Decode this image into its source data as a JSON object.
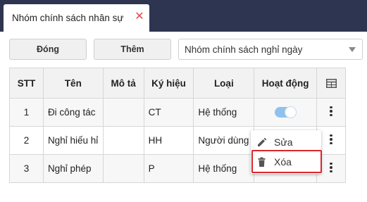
{
  "tab": {
    "title": "Nhóm chính sách nhân sự",
    "close_glyph": "✕"
  },
  "toolbar": {
    "close_label": "Đóng",
    "add_label": "Thêm",
    "policy_select_value": "Nhóm chính sách nghỉ ngày"
  },
  "table": {
    "headers": {
      "stt": "STT",
      "name": "Tên",
      "description": "Mô tả",
      "symbol": "Ký hiệu",
      "type": "Loại",
      "active": "Hoạt động",
      "columns_icon": "table-columns-icon"
    },
    "rows": [
      {
        "stt": "1",
        "name": "Đi công tác",
        "description": "",
        "symbol": "CT",
        "type": "Hệ thống",
        "active": true
      },
      {
        "stt": "2",
        "name": "Nghỉ hiếu hỉ",
        "description": "",
        "symbol": "HH",
        "type": "Người dùng",
        "active": null
      },
      {
        "stt": "3",
        "name": "Nghỉ phép",
        "description": "",
        "symbol": "P",
        "type": "Hệ thống",
        "active": null
      }
    ]
  },
  "context_menu": {
    "edit_label": "Sửa",
    "edit_icon": "pencil-icon",
    "delete_label": "Xóa",
    "delete_icon": "trash-icon"
  },
  "colors": {
    "topbar": "#2e3550",
    "close_icon": "#e04848",
    "toggle_on": "#8fc1ee",
    "highlight": "#d9262c"
  }
}
